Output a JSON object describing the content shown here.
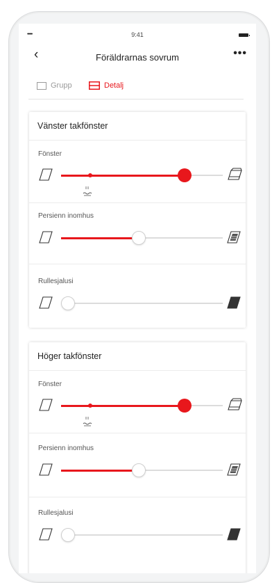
{
  "status_bar": {
    "time": "9:41",
    "signal": "•••••"
  },
  "nav": {
    "title": "Föräldrarnas sovrum",
    "back_icon": "chevron-left-icon",
    "more_icon": "more-icon",
    "more_glyph": "•••",
    "back_glyph": "‹"
  },
  "view_tabs": [
    {
      "label": "Grupp",
      "selected": false
    },
    {
      "label": "Detalj",
      "selected": true
    }
  ],
  "accent_color": "#e8171c",
  "groups": [
    {
      "title": "Vänster takfönster",
      "rows": [
        {
          "label": "Fönster",
          "value": 0.79,
          "rain_marker": 0.15
        },
        {
          "label": "Persienn inomhus",
          "value": 0.48
        },
        {
          "label": "Rullesjalusi",
          "value": 0.0
        }
      ]
    },
    {
      "title": "Höger takfönster",
      "rows": [
        {
          "label": "Fönster",
          "value": 0.79,
          "rain_marker": 0.15
        },
        {
          "label": "Persienn inomhus",
          "value": 0.48
        },
        {
          "label": "Rullesjalusi",
          "value": 0.0
        }
      ]
    }
  ]
}
